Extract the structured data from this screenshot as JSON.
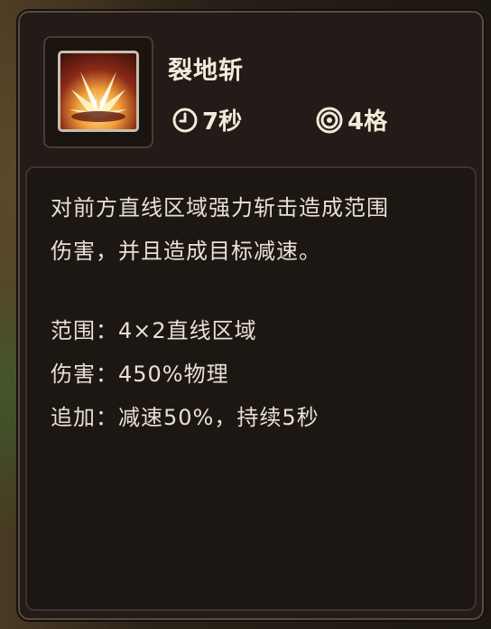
{
  "skill": {
    "name": "裂地斩",
    "icon": "ground-slash-burst-icon",
    "cooldown": "7秒",
    "cooldown_icon": "clock-icon",
    "range": "4格",
    "range_icon": "target-icon"
  },
  "description": {
    "lines": [
      "对前方直线区域强力斩击造成范围",
      "伤害，并且造成目标减速。"
    ]
  },
  "details": {
    "area": "范围：4×2直线区域",
    "damage": "伤害：450%物理",
    "extra": "追加：减速50%，持续5秒"
  },
  "colors": {
    "panel": "#221b17",
    "text": "#f3ead9",
    "border": "#5a4a3f"
  }
}
